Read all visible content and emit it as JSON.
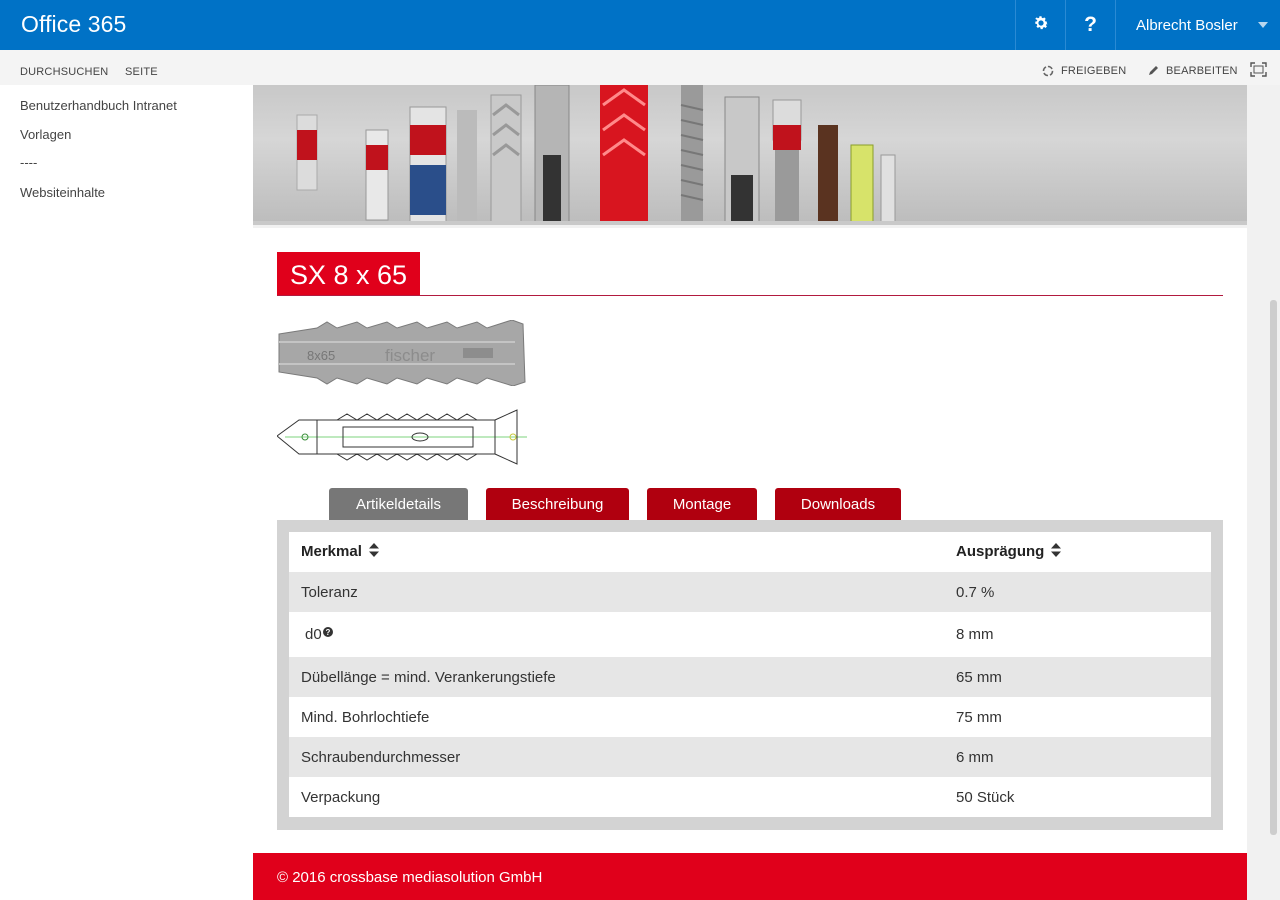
{
  "suite": {
    "title": "Office 365",
    "user_name": "Albrecht Bosler",
    "brand_color": "#0072c6"
  },
  "ribbon": {
    "tabs": [
      "DURCHSUCHEN",
      "SEITE"
    ],
    "share_label": "FREIGEBEN",
    "edit_label": "BEARBEITEN"
  },
  "leftnav": {
    "items": [
      "Benutzerhandbuch Intranet",
      "Vorlagen",
      "----",
      "Websiteinhalte"
    ]
  },
  "product": {
    "title": "SX 8 x 65",
    "accent_color": "#e0001b"
  },
  "tabs": [
    "Artikeldetails",
    "Beschreibung",
    "Montage",
    "Downloads"
  ],
  "table": {
    "headers": [
      "Merkmal",
      "Ausprägung"
    ],
    "rows": [
      {
        "name": "Toleranz",
        "value": "0.7 %"
      },
      {
        "name": "d0",
        "value": "8 mm"
      },
      {
        "name": "Dübellänge = mind. Verankerungstiefe",
        "value": "65 mm"
      },
      {
        "name": "Mind. Bohrlochtiefe",
        "value": "75 mm"
      },
      {
        "name": "Schraubendurchmesser",
        "value": "6 mm"
      },
      {
        "name": "Verpackung",
        "value": "50 Stück"
      }
    ]
  },
  "footer": {
    "text": "© 2016 crossbase mediasolution GmbH"
  }
}
